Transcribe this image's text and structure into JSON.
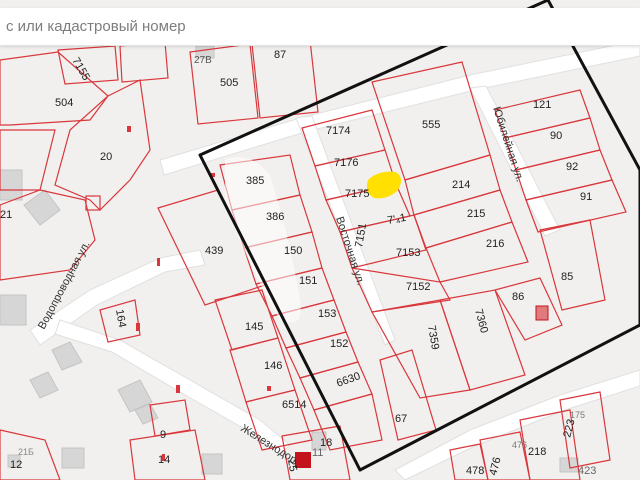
{
  "search": {
    "placeholder": "с или кадастровый номер",
    "value": ""
  },
  "colors": {
    "parcel": "#d9373c",
    "selection": "#111111",
    "highlight": "#ffe000",
    "building": "#d6d6d6",
    "background": "#f1f0ee",
    "road": "#ffffff"
  },
  "parcels": {
    "p7155": "7155",
    "p27b": "27В",
    "p505": "505",
    "p87": "87",
    "p504": "504",
    "p20": "20",
    "p21": "21",
    "p7174": "7174",
    "p555": "555",
    "p7176": "7176",
    "p7175": "7175",
    "p214": "214",
    "p7151_diag": "7'₄1",
    "p215": "215",
    "p7151": "7151",
    "p7153": "7153",
    "p216": "216",
    "p7152": "7152",
    "p121": "121",
    "p90": "90",
    "p92": "92",
    "p91": "91",
    "p85": "85",
    "p86": "86",
    "p385": "385",
    "p386": "386",
    "p150": "150",
    "p151": "151",
    "p153": "153",
    "p152": "152",
    "p6630": "6630",
    "p6514": "6514",
    "p439": "439",
    "p145": "145",
    "p146": "146",
    "p7359": "7359",
    "p7360": "7360",
    "p67": "67",
    "p18": "18",
    "p11": "11",
    "p25": "25",
    "p164": "164",
    "p9": "9",
    "p14": "14",
    "p12": "12",
    "p21b": "21Б",
    "p175": "175",
    "p223": "223",
    "p476a": "476",
    "p218": "218",
    "p478": "478",
    "p476b": "476",
    "p423": "423"
  },
  "streets": {
    "vodoprovodnaya": "Водопроводная ул.",
    "vostochnaya": "Восточная ул.",
    "yubileynaya": "Юбилейная ул.",
    "zheleznodor": "Железнодор"
  }
}
